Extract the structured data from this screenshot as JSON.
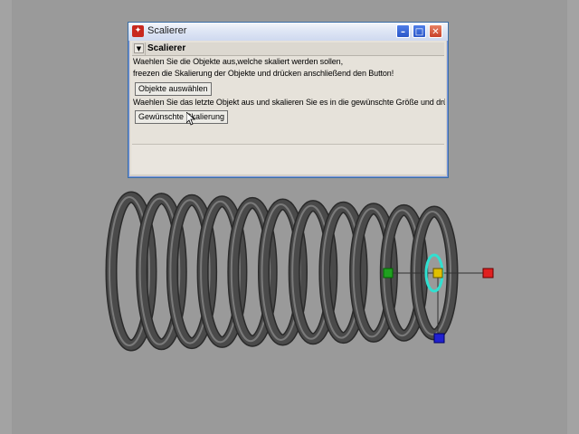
{
  "window": {
    "title": "Scalierer",
    "app_icon": "app-icon",
    "minimize_icon": "minimize-icon",
    "maximize_icon": "maximize-icon",
    "close_icon": "close-icon"
  },
  "frame": {
    "title": "Scalierer",
    "collapse_icon": "triangle-down-icon"
  },
  "instructions": {
    "line1": "Waehlen Sie die Objekte aus,welche skaliert werden sollen,",
    "line2": "freezen die Skalierung der Objekte und drücken anschließend den Button!",
    "line3": "Waehlen Sie das letzte Objekt aus und skalieren Sie es in die gewünschte Größe und drück"
  },
  "buttons": {
    "select_objects": "Objekte auswählen",
    "desired_scaling": "Gewünschte Skalierung"
  },
  "colors": {
    "viewport_bg": "#9a9a9a",
    "spring": "#4a4a4a",
    "manip_x": "#e02020",
    "manip_y": "#20a020",
    "manip_z": "#2020d0",
    "manip_center": "#e0c000",
    "rotate_ring": "#30e0d0"
  }
}
